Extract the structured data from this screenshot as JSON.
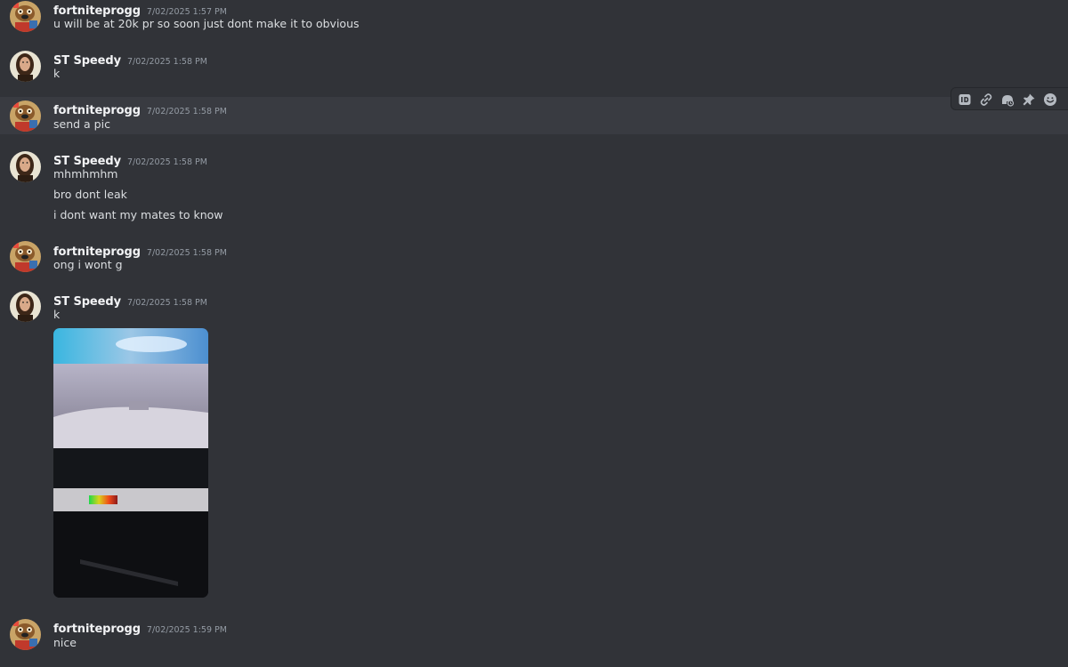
{
  "messages": [
    {
      "author": "fortniteprogg",
      "timestamp": "7/02/2025 1:57 PM",
      "lines": [
        "u will be at 20k pr so soon just dont make it to obvious"
      ]
    },
    {
      "author": "ST Speedy",
      "timestamp": "7/02/2025 1:58 PM",
      "lines": [
        "k"
      ]
    },
    {
      "author": "fortniteprogg",
      "timestamp": "7/02/2025 1:58 PM",
      "lines": [
        "send a pic"
      ]
    },
    {
      "author": "ST Speedy",
      "timestamp": "7/02/2025 1:58 PM",
      "lines": [
        "mhmhmhm",
        "bro dont leak",
        "i dont want my mates to know"
      ]
    },
    {
      "author": "fortniteprogg",
      "timestamp": "7/02/2025 1:58 PM",
      "lines": [
        "ong i wont g"
      ]
    },
    {
      "author": "ST Speedy",
      "timestamp": "7/02/2025 1:58 PM",
      "lines": [
        "k"
      ]
    },
    {
      "author": "fortniteprogg",
      "timestamp": "7/02/2025 1:59 PM",
      "lines": [
        "nice"
      ]
    }
  ],
  "toolbar": {
    "icons": [
      "copy-id-icon",
      "copy-link-icon",
      "reply-icon",
      "pin-icon",
      "emoji-icon"
    ]
  },
  "colors": {
    "background": "#313338",
    "hover_background": "#393b41",
    "username": "#f2f3f5",
    "timestamp": "#949ba4",
    "text": "#dbdee1",
    "icon": "#b5bac1"
  }
}
